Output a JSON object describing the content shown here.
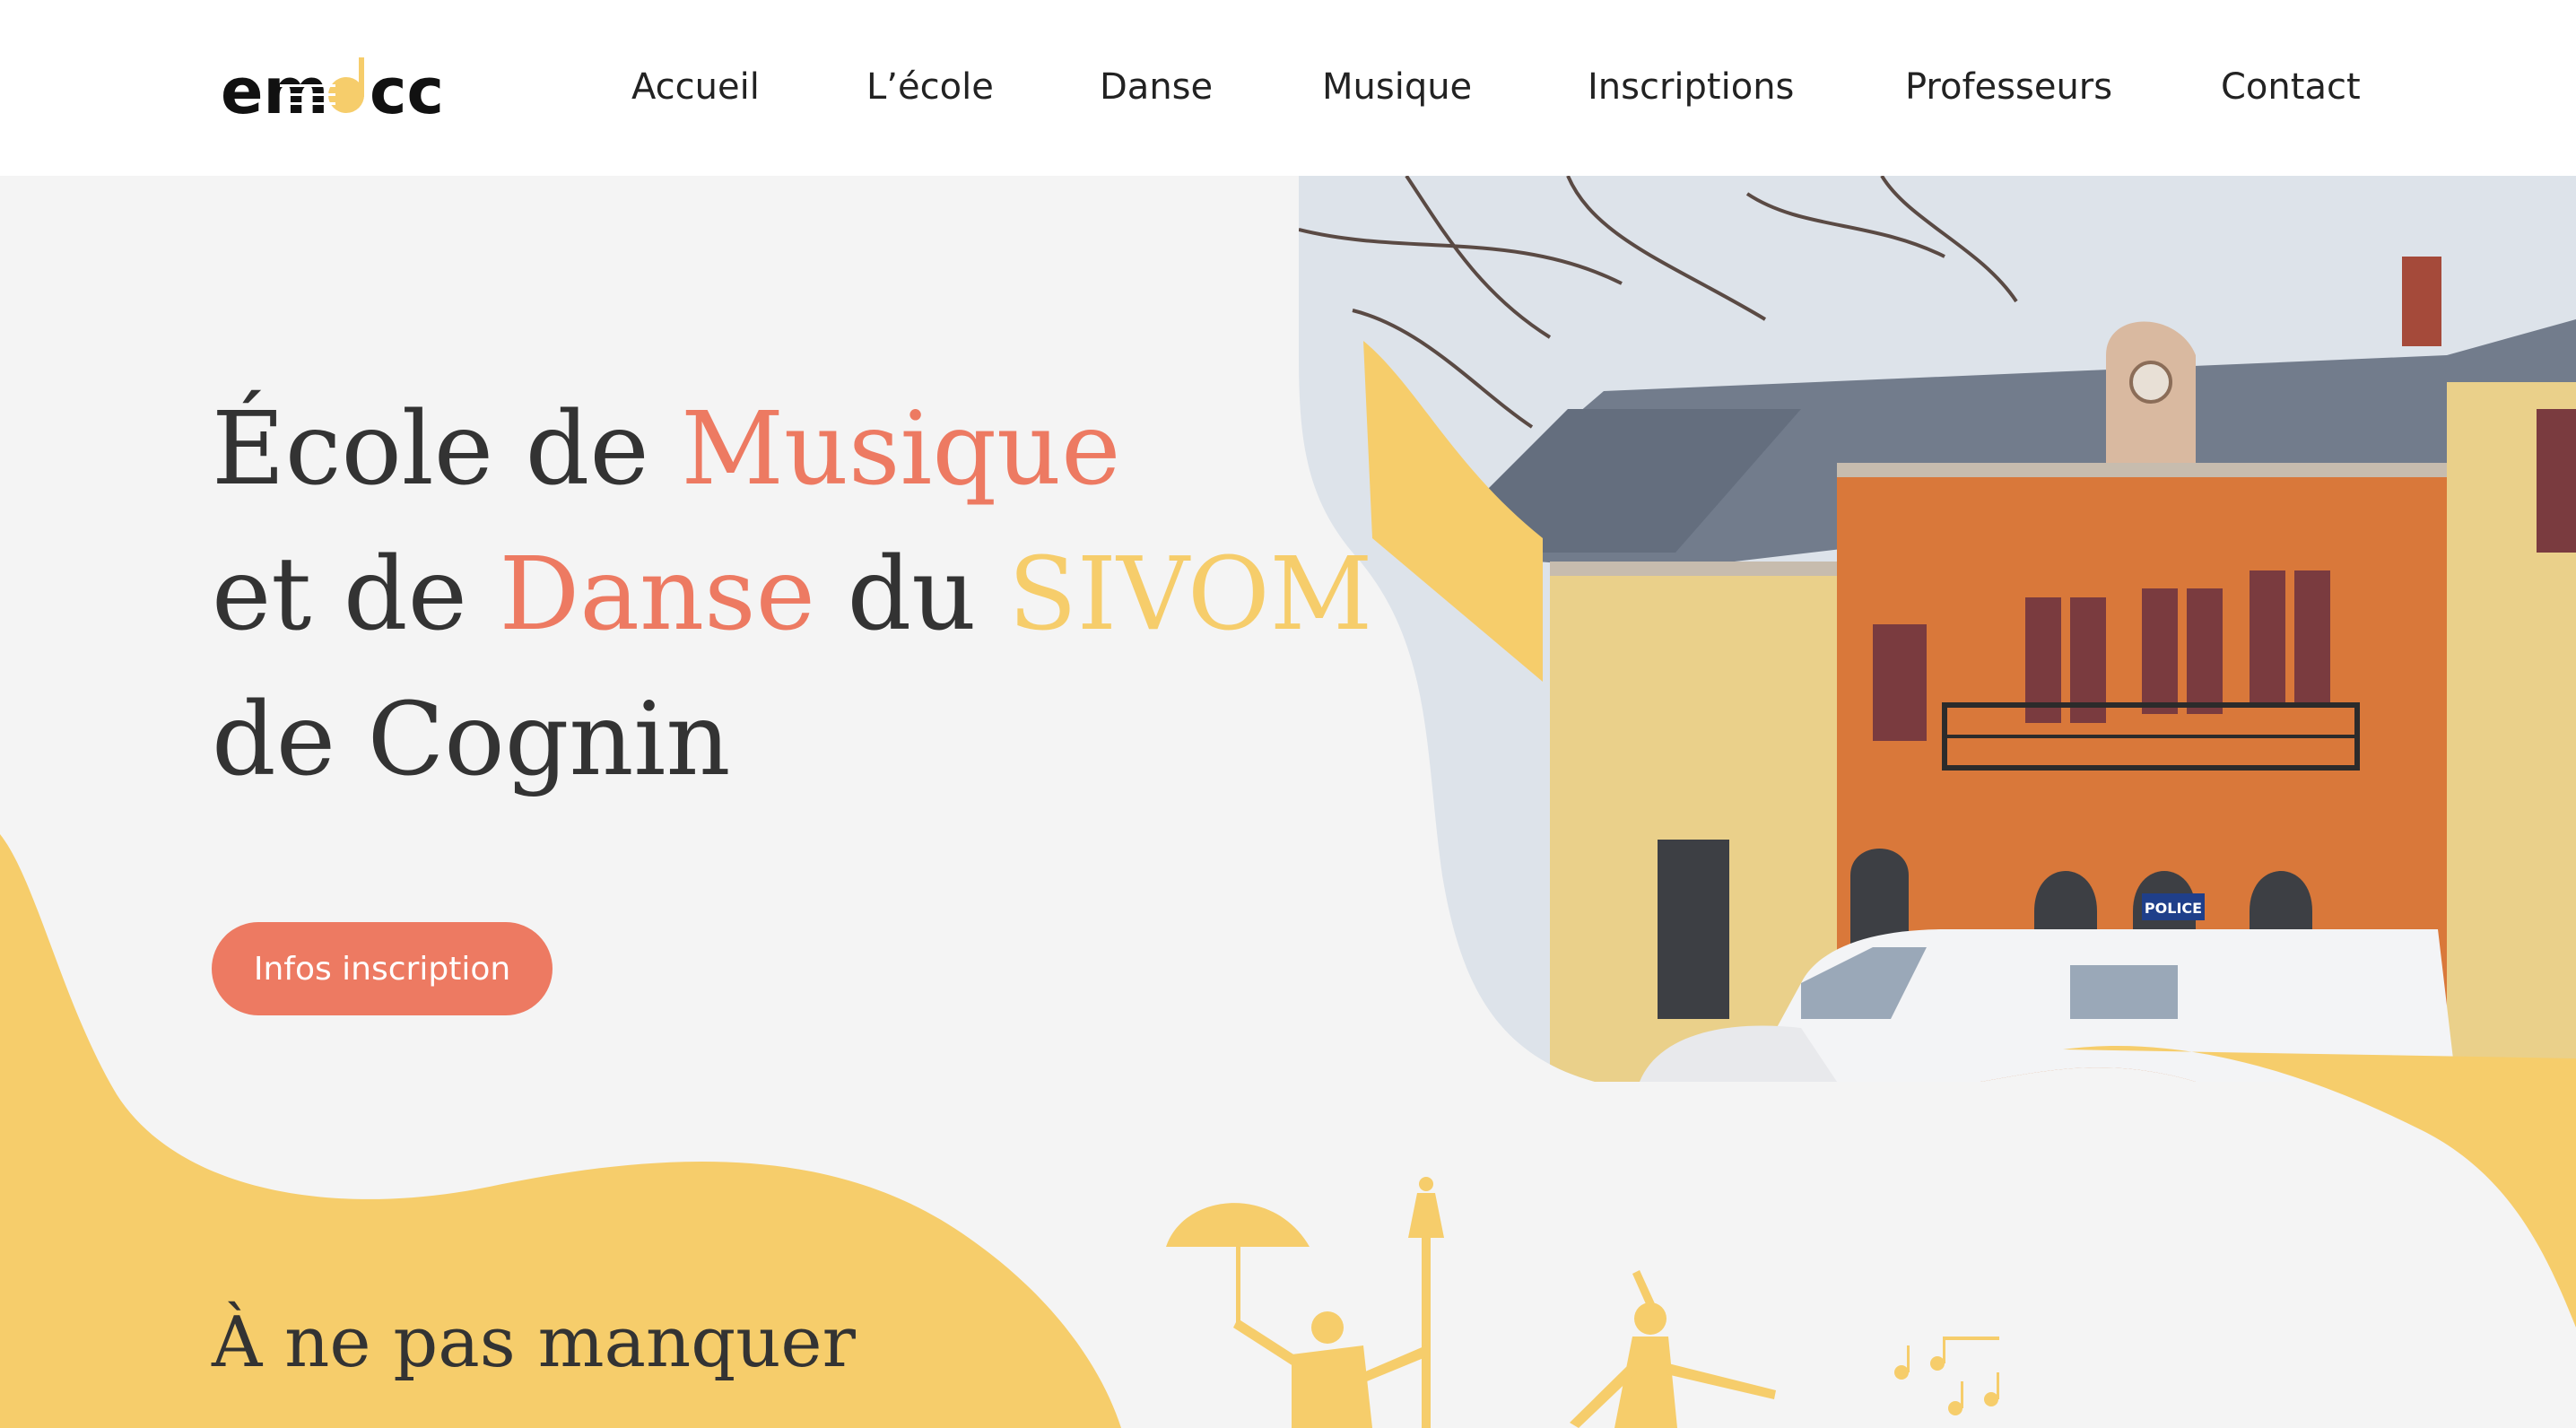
{
  "brand": {
    "logo_text": "emdcc",
    "colors": {
      "coral": "#ed7a62",
      "yellow": "#f6cd6b",
      "text": "#333333",
      "background": "#f4f4f4"
    }
  },
  "nav": {
    "items": [
      {
        "label": "Accueil"
      },
      {
        "label": "L’école"
      },
      {
        "label": "Danse"
      },
      {
        "label": "Musique"
      },
      {
        "label": "Inscriptions"
      },
      {
        "label": "Professeurs"
      },
      {
        "label": "Contact"
      }
    ]
  },
  "hero": {
    "title_parts": {
      "p1": "École de ",
      "p2": "Musique",
      "p3": "et de ",
      "p4": "Danse",
      "p5": " du ",
      "p6": "SIVOM",
      "p7": "de Cognin"
    },
    "cta_label": "Infos inscription",
    "image_icon": "building-photo",
    "police_sign": "POLICE"
  },
  "section": {
    "title": "À ne pas manquer"
  },
  "decor_icons": [
    "umbrella-dancer-icon",
    "street-lamp-icon",
    "dancer-icon",
    "music-notes-icon"
  ]
}
